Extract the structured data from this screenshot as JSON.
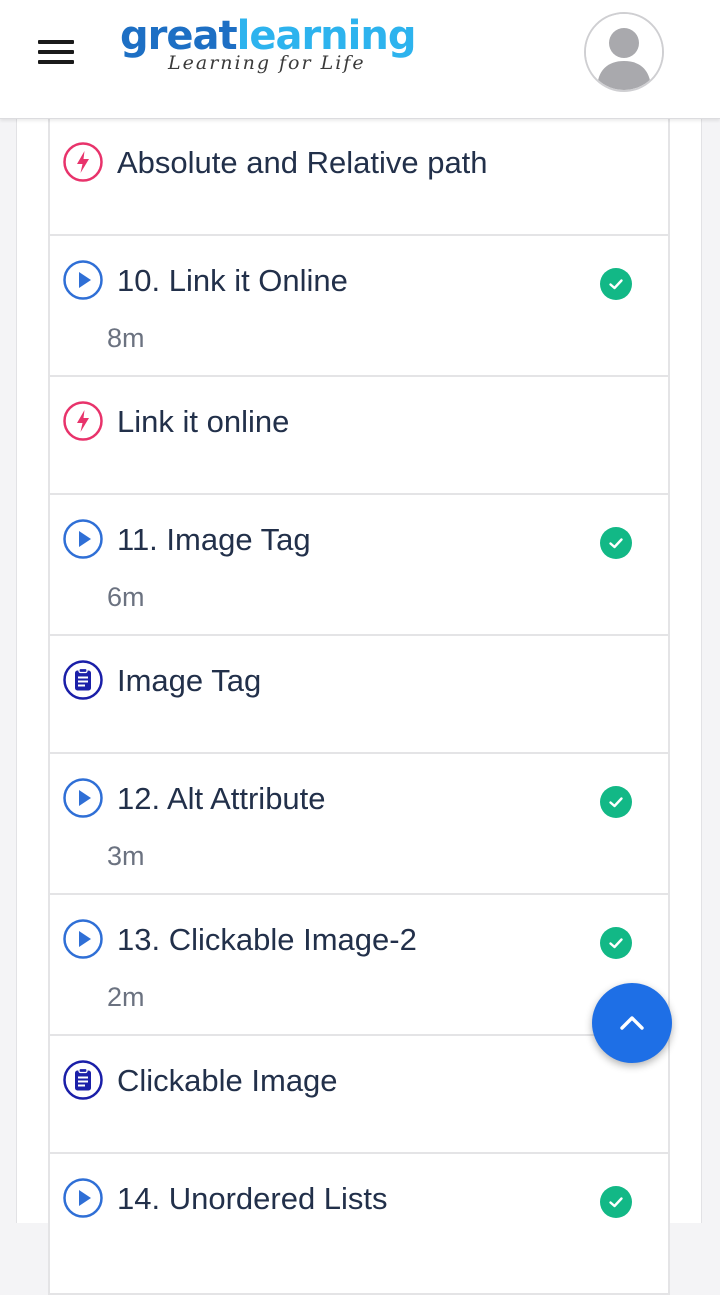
{
  "header": {
    "logo_great": "great",
    "logo_learning": "learning",
    "logo_tagline": "Learning for Life"
  },
  "colors": {
    "brand_dark_blue": "#1d6fc4",
    "brand_light_blue": "#2db3ee",
    "flash_pink": "#e8336b",
    "play_blue": "#2f6fd6",
    "quiz_navy": "#1a1fa8",
    "check_green": "#12b886",
    "fab_blue": "#1e6fe6"
  },
  "items": [
    {
      "type": "flash",
      "icon": "lightning-icon",
      "title": "Absolute and Relative path",
      "duration": "",
      "completed": false
    },
    {
      "type": "video",
      "icon": "play-icon",
      "title": "10. Link it Online",
      "duration": "8m",
      "completed": true
    },
    {
      "type": "flash",
      "icon": "lightning-icon",
      "title": "Link it online",
      "duration": "",
      "completed": false
    },
    {
      "type": "video",
      "icon": "play-icon",
      "title": "11. Image Tag",
      "duration": "6m",
      "completed": true
    },
    {
      "type": "quiz",
      "icon": "clipboard-icon",
      "title": "Image Tag",
      "duration": "",
      "completed": false
    },
    {
      "type": "video",
      "icon": "play-icon",
      "title": "12. Alt Attribute",
      "duration": "3m",
      "completed": true
    },
    {
      "type": "video",
      "icon": "play-icon",
      "title": "13. Clickable Image-2",
      "duration": "2m",
      "completed": true
    },
    {
      "type": "quiz",
      "icon": "clipboard-icon",
      "title": "Clickable Image",
      "duration": "",
      "completed": false
    },
    {
      "type": "video",
      "icon": "play-icon",
      "title": "14. Unordered Lists",
      "duration": "",
      "completed": true
    }
  ],
  "fab": {
    "icon": "chevron-up-icon"
  }
}
